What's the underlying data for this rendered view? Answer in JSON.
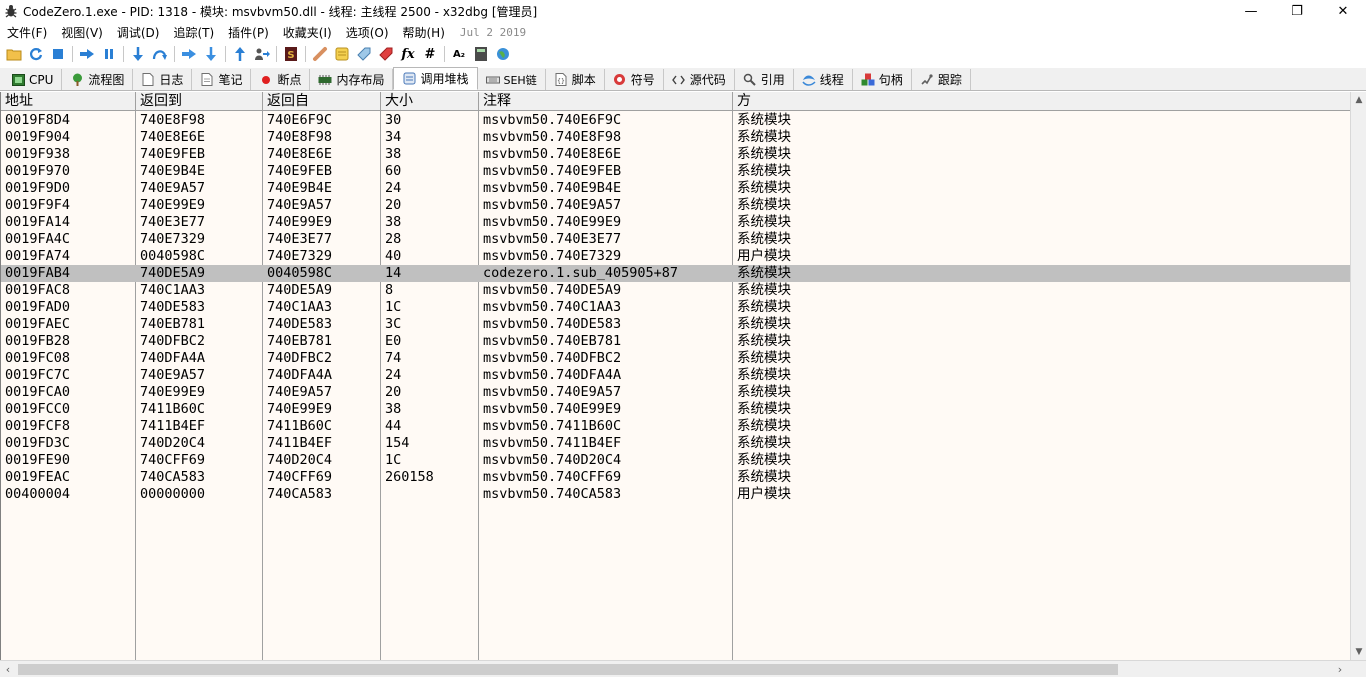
{
  "window": {
    "title": "CodeZero.1.exe - PID: 1318 - 模块: msvbvm50.dll - 线程: 主线程 2500 - x32dbg [管理员]",
    "minimize": "—",
    "maximize": "❐",
    "close": "✕"
  },
  "menu": {
    "items": [
      "文件(F)",
      "视图(V)",
      "调试(D)",
      "追踪(T)",
      "插件(P)",
      "收藏夹(I)",
      "选项(O)",
      "帮助(H)"
    ],
    "date": "Jul 2 2019"
  },
  "toolbar": {
    "text_icons": {
      "fx": "fx",
      "hash": "#",
      "az": "A₂"
    }
  },
  "tabs": [
    {
      "label": "CPU",
      "icon": "cpu-icon"
    },
    {
      "label": "流程图",
      "icon": "graph-icon"
    },
    {
      "label": "日志",
      "icon": "log-icon"
    },
    {
      "label": "笔记",
      "icon": "notes-icon"
    },
    {
      "label": "断点",
      "icon": "breakpoint-icon"
    },
    {
      "label": "内存布局",
      "icon": "memory-map-icon"
    },
    {
      "label": "调用堆栈",
      "icon": "call-stack-icon",
      "active": true
    },
    {
      "label": "SEH链",
      "icon": "seh-icon"
    },
    {
      "label": "脚本",
      "icon": "script-icon"
    },
    {
      "label": "符号",
      "icon": "symbols-icon"
    },
    {
      "label": "源代码",
      "icon": "source-icon"
    },
    {
      "label": "引用",
      "icon": "references-icon"
    },
    {
      "label": "线程",
      "icon": "threads-icon"
    },
    {
      "label": "句柄",
      "icon": "handles-icon"
    },
    {
      "label": "跟踪",
      "icon": "trace-icon"
    }
  ],
  "table": {
    "columns": [
      "地址",
      "返回到",
      "返回自",
      "大小",
      "注释",
      "方"
    ],
    "selected_row": 9,
    "rows": [
      [
        "0019F8D4",
        "740E8F98",
        "740E6F9C",
        "30",
        "msvbvm50.740E6F9C",
        "系统模块"
      ],
      [
        "0019F904",
        "740E8E6E",
        "740E8F98",
        "34",
        "msvbvm50.740E8F98",
        "系统模块"
      ],
      [
        "0019F938",
        "740E9FEB",
        "740E8E6E",
        "38",
        "msvbvm50.740E8E6E",
        "系统模块"
      ],
      [
        "0019F970",
        "740E9B4E",
        "740E9FEB",
        "60",
        "msvbvm50.740E9FEB",
        "系统模块"
      ],
      [
        "0019F9D0",
        "740E9A57",
        "740E9B4E",
        "24",
        "msvbvm50.740E9B4E",
        "系统模块"
      ],
      [
        "0019F9F4",
        "740E99E9",
        "740E9A57",
        "20",
        "msvbvm50.740E9A57",
        "系统模块"
      ],
      [
        "0019FA14",
        "740E3E77",
        "740E99E9",
        "38",
        "msvbvm50.740E99E9",
        "系统模块"
      ],
      [
        "0019FA4C",
        "740E7329",
        "740E3E77",
        "28",
        "msvbvm50.740E3E77",
        "系统模块"
      ],
      [
        "0019FA74",
        "0040598C",
        "740E7329",
        "40",
        "msvbvm50.740E7329",
        "用户模块"
      ],
      [
        "0019FAB4",
        "740DE5A9",
        "0040598C",
        "14",
        "codezero.1.sub_405905+87",
        "系统模块"
      ],
      [
        "0019FAC8",
        "740C1AA3",
        "740DE5A9",
        "8",
        "msvbvm50.740DE5A9",
        "系统模块"
      ],
      [
        "0019FAD0",
        "740DE583",
        "740C1AA3",
        "1C",
        "msvbvm50.740C1AA3",
        "系统模块"
      ],
      [
        "0019FAEC",
        "740EB781",
        "740DE583",
        "3C",
        "msvbvm50.740DE583",
        "系统模块"
      ],
      [
        "0019FB28",
        "740DFBC2",
        "740EB781",
        "E0",
        "msvbvm50.740EB781",
        "系统模块"
      ],
      [
        "0019FC08",
        "740DFA4A",
        "740DFBC2",
        "74",
        "msvbvm50.740DFBC2",
        "系统模块"
      ],
      [
        "0019FC7C",
        "740E9A57",
        "740DFA4A",
        "24",
        "msvbvm50.740DFA4A",
        "系统模块"
      ],
      [
        "0019FCA0",
        "740E99E9",
        "740E9A57",
        "20",
        "msvbvm50.740E9A57",
        "系统模块"
      ],
      [
        "0019FCC0",
        "7411B60C",
        "740E99E9",
        "38",
        "msvbvm50.740E99E9",
        "系统模块"
      ],
      [
        "0019FCF8",
        "7411B4EF",
        "7411B60C",
        "44",
        "msvbvm50.7411B60C",
        "系统模块"
      ],
      [
        "0019FD3C",
        "740D20C4",
        "7411B4EF",
        "154",
        "msvbvm50.7411B4EF",
        "系统模块"
      ],
      [
        "0019FE90",
        "740CFF69",
        "740D20C4",
        "1C",
        "msvbvm50.740D20C4",
        "系统模块"
      ],
      [
        "0019FEAC",
        "740CA583",
        "740CFF69",
        "260158",
        "msvbvm50.740CFF69",
        "系统模块"
      ],
      [
        "00400004",
        "00000000",
        "740CA583",
        "",
        "msvbvm50.740CA583",
        "用户模块"
      ]
    ]
  },
  "scroll": {
    "up": "▲",
    "down": "▼",
    "left": "‹",
    "right": "›"
  }
}
